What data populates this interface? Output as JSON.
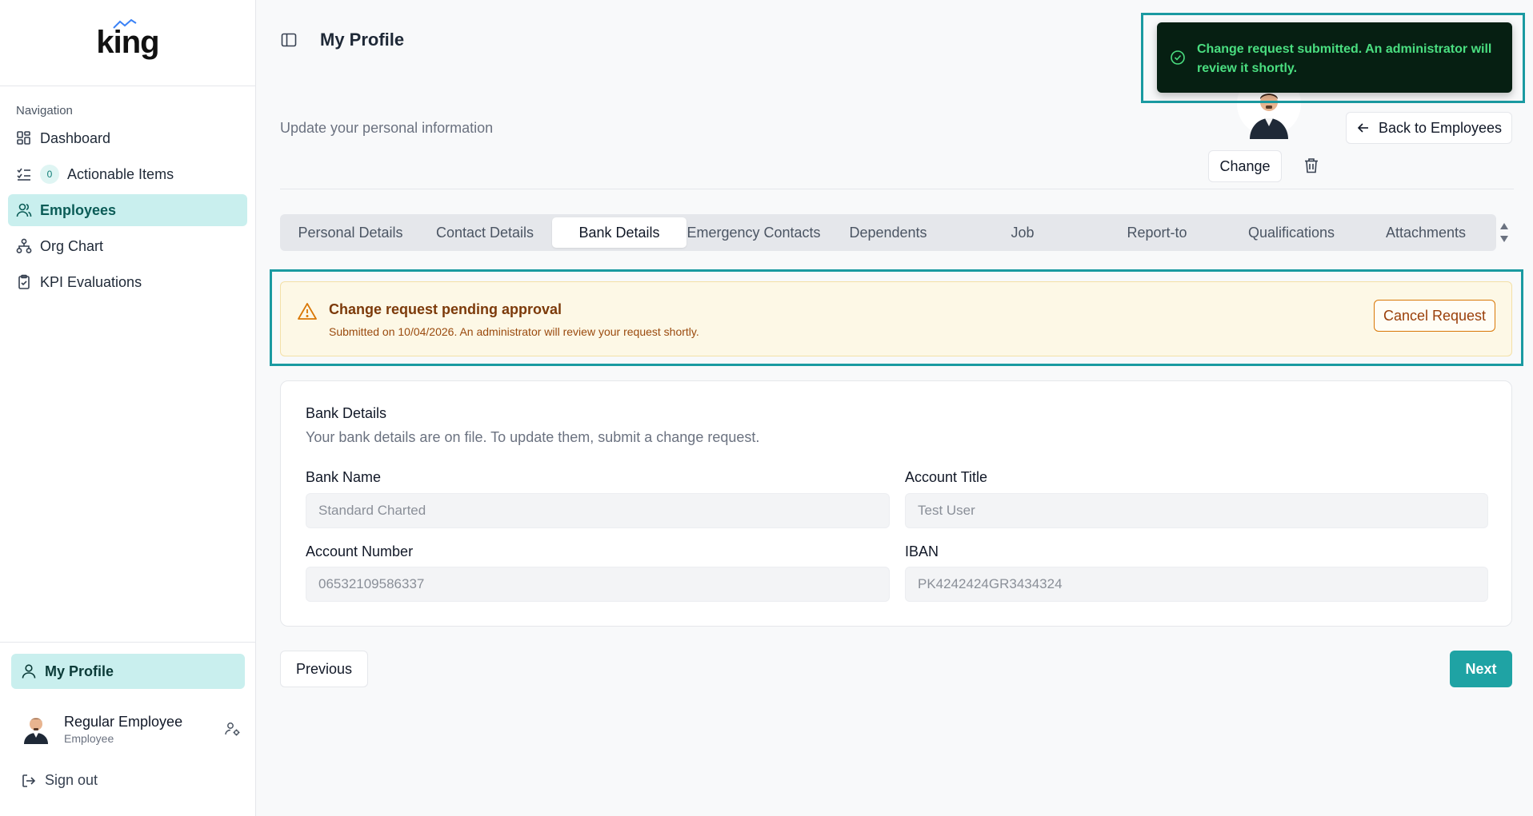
{
  "app": {
    "logo_text": "king"
  },
  "sidebar": {
    "heading": "Navigation",
    "items": [
      {
        "label": "Dashboard",
        "icon": "dashboard-icon"
      },
      {
        "label": "Actionable Items",
        "icon": "checklist-icon",
        "badge": "0"
      },
      {
        "label": "Employees",
        "icon": "users-icon",
        "active": true
      },
      {
        "label": "Org Chart",
        "icon": "org-chart-icon"
      },
      {
        "label": "KPI Evaluations",
        "icon": "clipboard-icon"
      }
    ],
    "profile_label": "My Profile",
    "user": {
      "name": "Regular Employee",
      "role": "Employee"
    },
    "signout_label": "Sign out"
  },
  "header": {
    "title": "My Profile"
  },
  "profile": {
    "subtitle": "Update your personal information",
    "back_label": "Back to Employees",
    "change_label": "Change"
  },
  "tabs": [
    {
      "label": "Personal Details"
    },
    {
      "label": "Contact Details"
    },
    {
      "label": "Bank Details",
      "active": true
    },
    {
      "label": "Emergency Contacts"
    },
    {
      "label": "Dependents"
    },
    {
      "label": "Job"
    },
    {
      "label": "Report-to"
    },
    {
      "label": "Qualifications"
    },
    {
      "label": "Attachments"
    }
  ],
  "banner": {
    "title": "Change request pending approval",
    "subtitle": "Submitted on 10/04/2026. An administrator will review your request shortly.",
    "cancel_label": "Cancel Request"
  },
  "bank": {
    "title": "Bank Details",
    "description": "Your bank details are on file. To update them, submit a change request.",
    "fields": {
      "bank_name": {
        "label": "Bank Name",
        "value": "Standard Charted"
      },
      "account_title": {
        "label": "Account Title",
        "value": "Test User"
      },
      "account_number": {
        "label": "Account Number",
        "value": "06532109586337"
      },
      "iban": {
        "label": "IBAN",
        "value": "PK4242424GR3434324"
      }
    }
  },
  "footer": {
    "previous_label": "Previous",
    "next_label": "Next"
  },
  "toast": {
    "message": "Change request submitted. An administrator will review it shortly."
  },
  "colors": {
    "accent": "#1fa3a4",
    "active_nav_bg": "#c9efee",
    "toast_bg": "#061f12",
    "toast_text": "#4ade80",
    "warning_bg": "#fdf8e6",
    "warning_text": "#7c3a0a",
    "highlight": "#1a9aa1"
  }
}
